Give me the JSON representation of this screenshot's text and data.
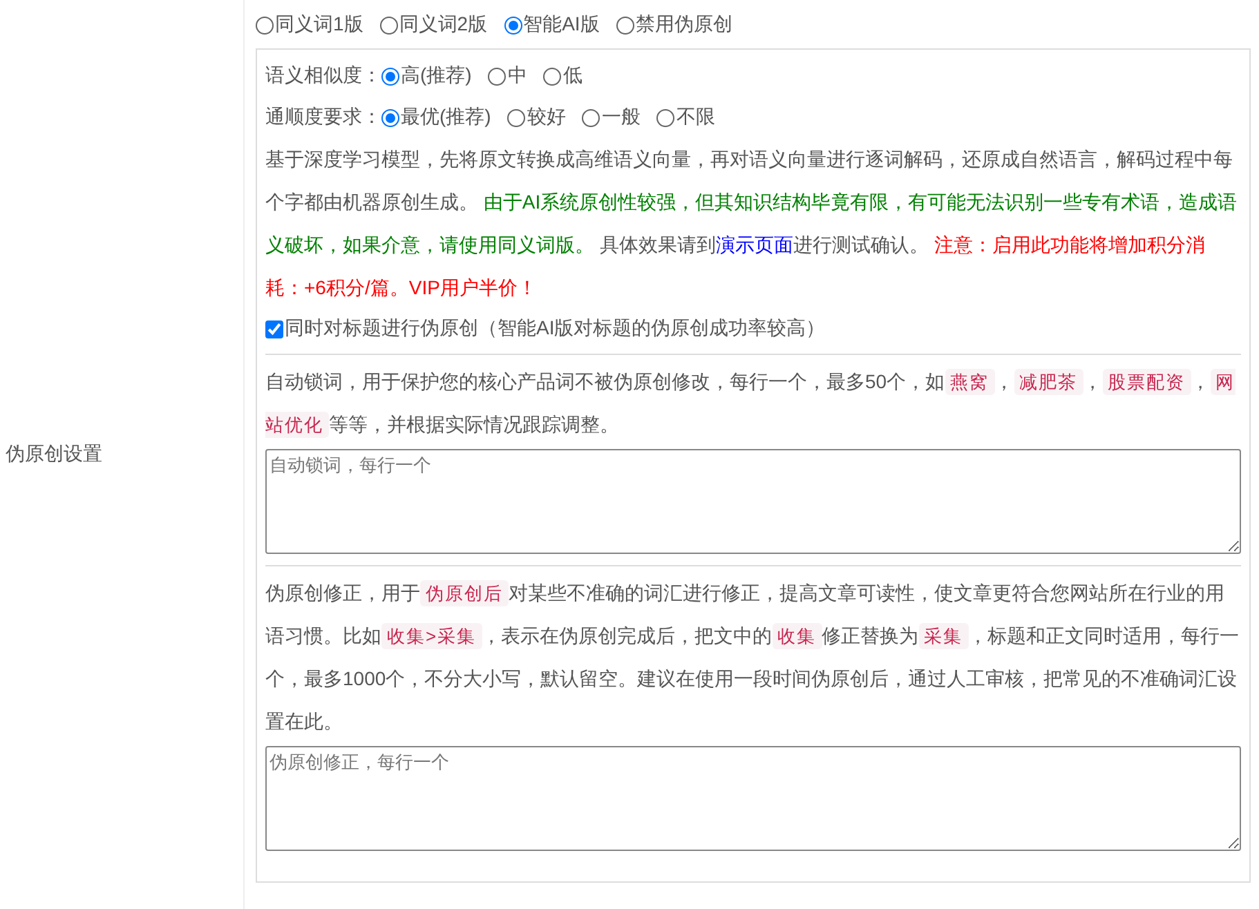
{
  "mode_options": [
    {
      "label": "同义词1版",
      "selected": false
    },
    {
      "label": "同义词2版",
      "selected": false
    },
    {
      "label": "智能AI版",
      "selected": true
    },
    {
      "label": "禁用伪原创",
      "selected": false
    }
  ],
  "settings_label": "伪原创设置",
  "similarity": {
    "label": "语义相似度：",
    "options": [
      {
        "label": "高(推荐)",
        "selected": true
      },
      {
        "label": "中",
        "selected": false
      },
      {
        "label": "低",
        "selected": false
      }
    ]
  },
  "fluency": {
    "label": "通顺度要求：",
    "options": [
      {
        "label": "最优(推荐)",
        "selected": true
      },
      {
        "label": "较好",
        "selected": false
      },
      {
        "label": "一般",
        "selected": false
      },
      {
        "label": "不限",
        "selected": false
      }
    ]
  },
  "description": [
    {
      "kind": "plain",
      "text": "基于深度学习模型，先将原文转换成高维语义向量，再对语义向量进行逐词解码，还原成自然语言，解码过程中每个字都由机器原创生成。 "
    },
    {
      "kind": "note",
      "text": "由于AI系统原创性较强，但其知识结构毕竟有限，有可能无法识别一些专有术语，造成语义破坏，如果介意，请使用同义词版。"
    },
    {
      "kind": "plain",
      "text": " 具体效果请到"
    },
    {
      "kind": "link",
      "text": "演示页面"
    },
    {
      "kind": "plain",
      "text": "进行测试确认。 "
    },
    {
      "kind": "warning",
      "text": "注意：启用此功能将增加积分消耗：+6积分/篇。VIP用户半价！"
    }
  ],
  "title_checkbox": {
    "label": "同时对标题进行伪原创（智能AI版对标题的伪原创成功率较高）",
    "checked": true
  },
  "lock_words": {
    "description": [
      {
        "kind": "plain",
        "text": "自动锁词，用于保护您的核心产品词不被伪原创修改，每行一个，最多50个，如"
      },
      {
        "kind": "code",
        "text": "燕窝"
      },
      {
        "kind": "plain",
        "text": "，"
      },
      {
        "kind": "code",
        "text": "减肥茶"
      },
      {
        "kind": "plain",
        "text": "，"
      },
      {
        "kind": "code",
        "text": "股票配资"
      },
      {
        "kind": "plain",
        "text": "，"
      },
      {
        "kind": "code",
        "text": "网站优化"
      },
      {
        "kind": "plain",
        "text": "等等，并根据实际情况跟踪调整。"
      }
    ],
    "placeholder": "自动锁词，每行一个"
  },
  "corrections": {
    "description": [
      {
        "kind": "plain",
        "text": "伪原创修正，用于"
      },
      {
        "kind": "code",
        "text": "伪原创后"
      },
      {
        "kind": "plain",
        "text": "对某些不准确的词汇进行修正，提高文章可读性，使文章更符合您网站所在行业的用语习惯。比如"
      },
      {
        "kind": "code",
        "text": "收集>采集"
      },
      {
        "kind": "plain",
        "text": "，表示在伪原创完成后，把文中的"
      },
      {
        "kind": "code",
        "text": "收集"
      },
      {
        "kind": "plain",
        "text": "修正替换为"
      },
      {
        "kind": "code",
        "text": "采集"
      },
      {
        "kind": "plain",
        "text": "，标题和正文同时适用，每行一个，最多1000个，不分大小写，默认留空。建议在使用一段时间伪原创后，通过人工审核，把常见的不准确词汇设置在此。"
      }
    ],
    "placeholder": "伪原创修正，每行一个"
  }
}
